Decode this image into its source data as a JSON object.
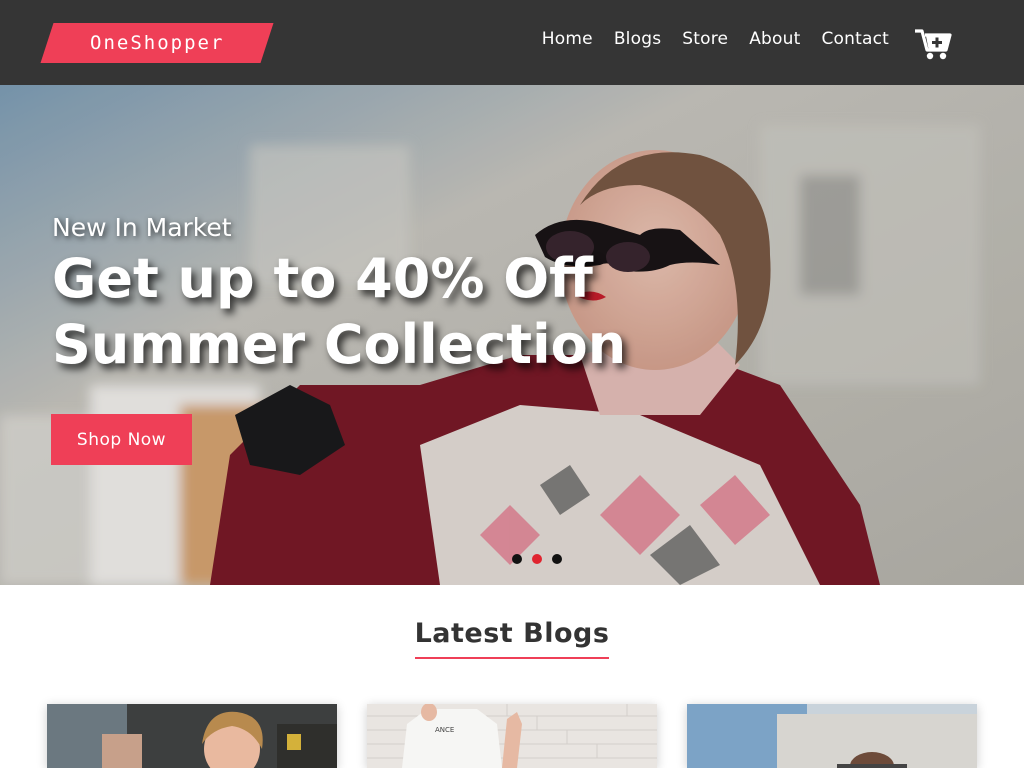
{
  "brand": {
    "name": "OneShopper",
    "color": "#ef3f57"
  },
  "nav": {
    "items": [
      {
        "label": "Home"
      },
      {
        "label": "Blogs"
      },
      {
        "label": "Store"
      },
      {
        "label": "About"
      },
      {
        "label": "Contact"
      }
    ],
    "cart_icon": "cart-plus-icon"
  },
  "hero": {
    "subtitle": "New In Market",
    "title_line1": "Get up to 40% Off",
    "title_line2": "Summer Collection",
    "button_label": "Shop Now",
    "carousel": {
      "slides": 3,
      "active_index": 1
    }
  },
  "blogs": {
    "heading": "Latest Blogs",
    "cards": [
      {
        "image": "woman-laughing-photo"
      },
      {
        "image": "woman-brick-wall-photo"
      },
      {
        "image": "woman-outdoor-photo"
      }
    ]
  },
  "colors": {
    "accent": "#ef3f57",
    "navbar": "#353535",
    "active_dot": "#e0242f"
  }
}
